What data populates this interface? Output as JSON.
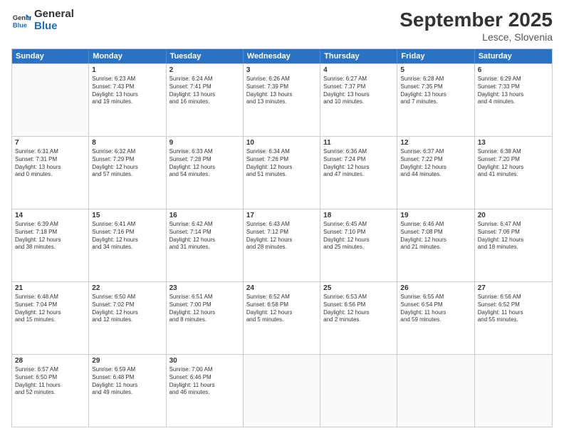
{
  "header": {
    "logo_general": "General",
    "logo_blue": "Blue",
    "month_title": "September 2025",
    "location": "Lesce, Slovenia"
  },
  "days_of_week": [
    "Sunday",
    "Monday",
    "Tuesday",
    "Wednesday",
    "Thursday",
    "Friday",
    "Saturday"
  ],
  "weeks": [
    [
      {
        "day": "",
        "info": ""
      },
      {
        "day": "1",
        "info": "Sunrise: 6:23 AM\nSunset: 7:43 PM\nDaylight: 13 hours\nand 19 minutes."
      },
      {
        "day": "2",
        "info": "Sunrise: 6:24 AM\nSunset: 7:41 PM\nDaylight: 13 hours\nand 16 minutes."
      },
      {
        "day": "3",
        "info": "Sunrise: 6:26 AM\nSunset: 7:39 PM\nDaylight: 13 hours\nand 13 minutes."
      },
      {
        "day": "4",
        "info": "Sunrise: 6:27 AM\nSunset: 7:37 PM\nDaylight: 13 hours\nand 10 minutes."
      },
      {
        "day": "5",
        "info": "Sunrise: 6:28 AM\nSunset: 7:35 PM\nDaylight: 13 hours\nand 7 minutes."
      },
      {
        "day": "6",
        "info": "Sunrise: 6:29 AM\nSunset: 7:33 PM\nDaylight: 13 hours\nand 4 minutes."
      }
    ],
    [
      {
        "day": "7",
        "info": "Sunrise: 6:31 AM\nSunset: 7:31 PM\nDaylight: 13 hours\nand 0 minutes."
      },
      {
        "day": "8",
        "info": "Sunrise: 6:32 AM\nSunset: 7:29 PM\nDaylight: 12 hours\nand 57 minutes."
      },
      {
        "day": "9",
        "info": "Sunrise: 6:33 AM\nSunset: 7:28 PM\nDaylight: 12 hours\nand 54 minutes."
      },
      {
        "day": "10",
        "info": "Sunrise: 6:34 AM\nSunset: 7:26 PM\nDaylight: 12 hours\nand 51 minutes."
      },
      {
        "day": "11",
        "info": "Sunrise: 6:36 AM\nSunset: 7:24 PM\nDaylight: 12 hours\nand 47 minutes."
      },
      {
        "day": "12",
        "info": "Sunrise: 6:37 AM\nSunset: 7:22 PM\nDaylight: 12 hours\nand 44 minutes."
      },
      {
        "day": "13",
        "info": "Sunrise: 6:38 AM\nSunset: 7:20 PM\nDaylight: 12 hours\nand 41 minutes."
      }
    ],
    [
      {
        "day": "14",
        "info": "Sunrise: 6:39 AM\nSunset: 7:18 PM\nDaylight: 12 hours\nand 38 minutes."
      },
      {
        "day": "15",
        "info": "Sunrise: 6:41 AM\nSunset: 7:16 PM\nDaylight: 12 hours\nand 34 minutes."
      },
      {
        "day": "16",
        "info": "Sunrise: 6:42 AM\nSunset: 7:14 PM\nDaylight: 12 hours\nand 31 minutes."
      },
      {
        "day": "17",
        "info": "Sunrise: 6:43 AM\nSunset: 7:12 PM\nDaylight: 12 hours\nand 28 minutes."
      },
      {
        "day": "18",
        "info": "Sunrise: 6:45 AM\nSunset: 7:10 PM\nDaylight: 12 hours\nand 25 minutes."
      },
      {
        "day": "19",
        "info": "Sunrise: 6:46 AM\nSunset: 7:08 PM\nDaylight: 12 hours\nand 21 minutes."
      },
      {
        "day": "20",
        "info": "Sunrise: 6:47 AM\nSunset: 7:06 PM\nDaylight: 12 hours\nand 18 minutes."
      }
    ],
    [
      {
        "day": "21",
        "info": "Sunrise: 6:48 AM\nSunset: 7:04 PM\nDaylight: 12 hours\nand 15 minutes."
      },
      {
        "day": "22",
        "info": "Sunrise: 6:50 AM\nSunset: 7:02 PM\nDaylight: 12 hours\nand 12 minutes."
      },
      {
        "day": "23",
        "info": "Sunrise: 6:51 AM\nSunset: 7:00 PM\nDaylight: 12 hours\nand 8 minutes."
      },
      {
        "day": "24",
        "info": "Sunrise: 6:52 AM\nSunset: 6:58 PM\nDaylight: 12 hours\nand 5 minutes."
      },
      {
        "day": "25",
        "info": "Sunrise: 6:53 AM\nSunset: 6:56 PM\nDaylight: 12 hours\nand 2 minutes."
      },
      {
        "day": "26",
        "info": "Sunrise: 6:55 AM\nSunset: 6:54 PM\nDaylight: 11 hours\nand 59 minutes."
      },
      {
        "day": "27",
        "info": "Sunrise: 6:56 AM\nSunset: 6:52 PM\nDaylight: 11 hours\nand 55 minutes."
      }
    ],
    [
      {
        "day": "28",
        "info": "Sunrise: 6:57 AM\nSunset: 6:50 PM\nDaylight: 11 hours\nand 52 minutes."
      },
      {
        "day": "29",
        "info": "Sunrise: 6:59 AM\nSunset: 6:48 PM\nDaylight: 11 hours\nand 49 minutes."
      },
      {
        "day": "30",
        "info": "Sunrise: 7:00 AM\nSunset: 6:46 PM\nDaylight: 11 hours\nand 46 minutes."
      },
      {
        "day": "",
        "info": ""
      },
      {
        "day": "",
        "info": ""
      },
      {
        "day": "",
        "info": ""
      },
      {
        "day": "",
        "info": ""
      }
    ]
  ]
}
